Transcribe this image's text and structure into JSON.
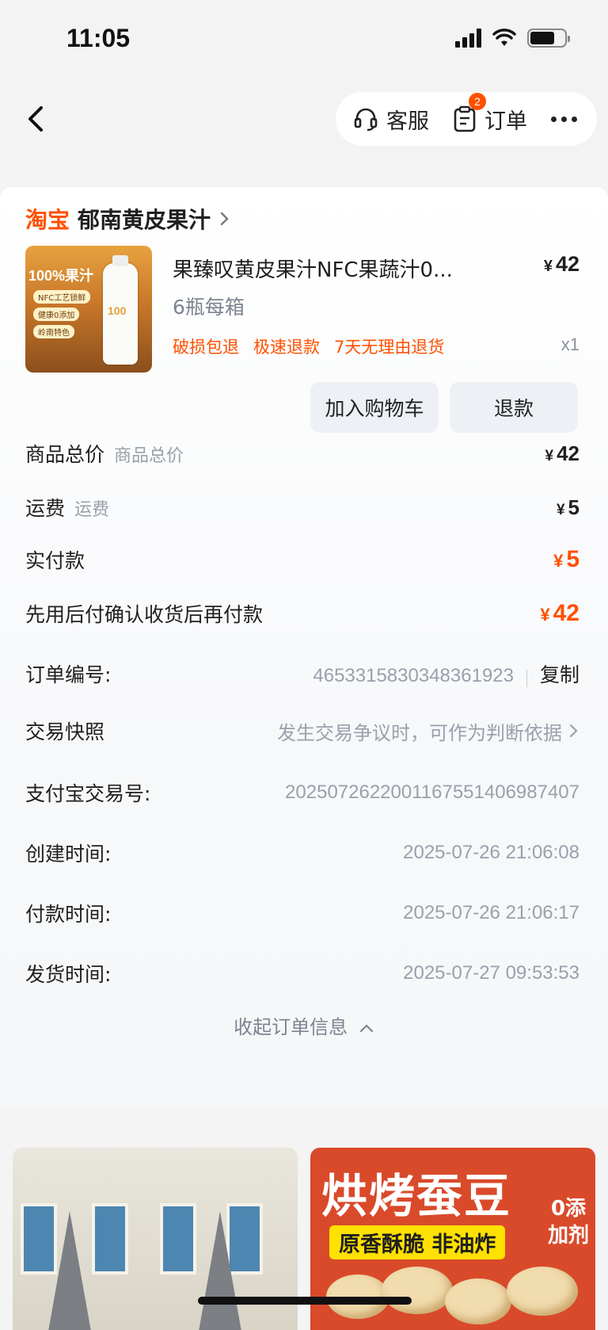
{
  "status_bar": {
    "time": "11:05"
  },
  "nav": {
    "service_label": "客服",
    "orders_label": "订单",
    "orders_badge": "2"
  },
  "shop": {
    "brand": "淘宝",
    "name": "郁南黄皮果汁"
  },
  "product": {
    "image_title": "100%果汁",
    "image_tags": [
      "NFC工艺锁鲜",
      "健康0添加",
      "岭南特色"
    ],
    "image_bottle_text": "100",
    "title": "果臻叹黄皮果汁NFC果蔬汁0...",
    "price_symbol": "¥",
    "price": "42",
    "spec": "6瓶每箱",
    "tags": [
      "破损包退",
      "极速退款",
      "7天无理由退货"
    ],
    "quantity": "x1"
  },
  "actions": {
    "add_cart": "加入购物车",
    "refund": "退款"
  },
  "summary": {
    "total_label": "商品总价",
    "total_sub": "商品总价",
    "total_value": "42",
    "shipping_label": "运费",
    "shipping_sub": "运费",
    "shipping_value": "5",
    "paid_label": "实付款",
    "paid_value": "5",
    "later_label": "先用后付确认收货后再付款",
    "later_value": "42",
    "currency": "¥"
  },
  "order_info": {
    "order_no_label": "订单编号:",
    "order_no": "4653315830348361923",
    "copy": "复制",
    "snapshot_label": "交易快照",
    "snapshot_value": "发生交易争议时，可作为判断依据",
    "alipay_label": "支付宝交易号:",
    "alipay_no": "2025072622001167551406987407",
    "created_label": "创建时间:",
    "created": "2025-07-26 21:06:08",
    "paid_label": "付款时间:",
    "paid": "2025-07-26 21:06:17",
    "shipped_label": "发货时间:",
    "shipped": "2025-07-27 09:53:53",
    "collapse": "收起订单信息"
  },
  "recommendations": {
    "right_title": "烘烤蚕豆",
    "right_band": "原香酥脆 非油炸",
    "right_side": [
      "0添",
      "加剂"
    ]
  },
  "colors": {
    "accent": "#ff5000",
    "muted": "#9aa0ab"
  }
}
